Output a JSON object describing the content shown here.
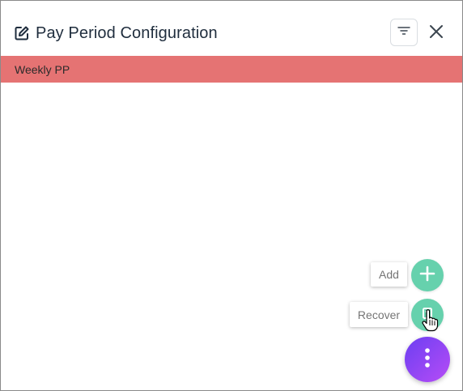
{
  "dialog": {
    "title": "Pay Period Configuration",
    "icons": {
      "title": "edit-icon",
      "filter": "filter-icon",
      "close": "close-icon"
    }
  },
  "list": {
    "items": [
      {
        "label": "Weekly PP",
        "highlight_color": "#e57373"
      }
    ]
  },
  "speed_dial": {
    "actions": [
      {
        "label": "Add",
        "icon": "plus-icon"
      },
      {
        "label": "Recover",
        "icon": "recover-icon"
      }
    ],
    "main_icon": "more-vertical-icon",
    "action_color": "#66d1ad",
    "main_gradient": [
      "#6c3ff2",
      "#b64cf6"
    ]
  }
}
